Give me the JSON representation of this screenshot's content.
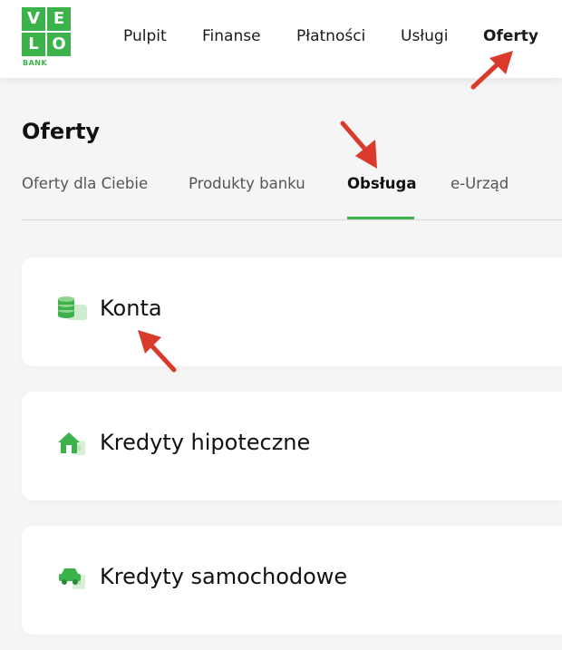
{
  "logo": {
    "letters": [
      "V",
      "E",
      "L",
      "O"
    ],
    "sub": "BANK"
  },
  "nav": {
    "items": [
      {
        "label": "Pulpit",
        "active": false
      },
      {
        "label": "Finanse",
        "active": false
      },
      {
        "label": "Płatności",
        "active": false
      },
      {
        "label": "Usługi",
        "active": false
      },
      {
        "label": "Oferty",
        "active": true
      }
    ]
  },
  "page": {
    "title": "Oferty"
  },
  "tabs": [
    {
      "label": "Oferty dla Ciebie",
      "active": false
    },
    {
      "label": "Produkty banku",
      "active": false
    },
    {
      "label": "Obsługa",
      "active": true
    },
    {
      "label": "e-Urząd",
      "active": false
    }
  ],
  "cards": [
    {
      "label": "Konta",
      "icon": "coins-wallet-icon"
    },
    {
      "label": "Kredyty hipoteczne",
      "icon": "house-icon"
    },
    {
      "label": "Kredyty samochodowe",
      "icon": "car-icon"
    }
  ],
  "colors": {
    "brand": "#3cb24a",
    "annotation_arrow": "#d93a2b",
    "background": "#f5f5f5"
  }
}
